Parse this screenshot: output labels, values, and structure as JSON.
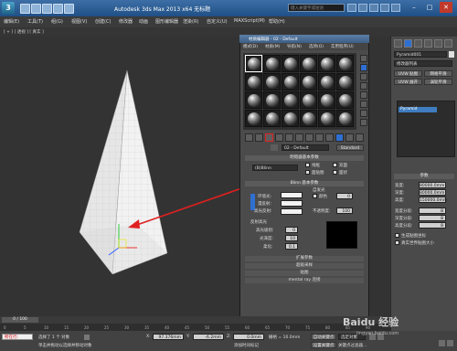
{
  "window": {
    "title": "Autodesk 3ds Max  2013 x64    无标题",
    "search_placeholder": "键入关键字或短语",
    "controls": [
      "–",
      "□",
      "✕"
    ]
  },
  "menubar": {
    "items": [
      "编辑(E)",
      "工具(T)",
      "组(G)",
      "视图(V)",
      "创建(C)",
      "修改器",
      "动画",
      "图形编辑器",
      "渲染(R)",
      "自定义(U)",
      "MAXScript(M)",
      "帮助(H)"
    ]
  },
  "viewport": {
    "label": "[ + ] [ 透视 ] [ 真实 ]"
  },
  "material_editor": {
    "title": "材质编辑器 - 02 - Default",
    "menu": [
      "模式(D)",
      "材质(M)",
      "导航(N)",
      "选项(O)",
      "实用程序(U)"
    ],
    "material_name": "02 - Default",
    "material_type": "Standard",
    "shader_rollout": "明暗器基本参数",
    "shader_type": "(B)Blinn",
    "shader_options": [
      "线框",
      "双面",
      "面贴图",
      "面状"
    ],
    "blinn_rollout": "Blinn 基本参数",
    "self_illum_label": "自发光",
    "color_label": "颜色",
    "color_value": "0",
    "ambient_label": "环境光:",
    "diffuse_label": "漫反射:",
    "specular_label": "高光反射:",
    "opacity_label": "不透明度:",
    "opacity_value": "100",
    "specular_highlights_label": "反射高光",
    "specular_level_label": "高光级别:",
    "specular_level_value": "0",
    "glossiness_label": "光泽度:",
    "glossiness_value": "10",
    "soften_label": "柔化:",
    "soften_value": "0.1",
    "closed_rollouts": [
      "扩展参数",
      "超级采样",
      "贴图",
      "mental ray 连接"
    ]
  },
  "command_panel": {
    "object_name": "Pyramid001",
    "modifier_list": "修改器列表",
    "buttons": [
      "UVW 贴图",
      "网格平滑",
      "UVW 展开",
      "涡轮平滑"
    ],
    "modifier_stack_item": "Pyramid",
    "params_header": "参数",
    "params": [
      {
        "label": "宽度:",
        "value": "80000.0mm"
      },
      {
        "label": "深度:",
        "value": "80000.0mm"
      },
      {
        "label": "高度:",
        "value": "150000.0mm"
      },
      {
        "label": "宽度分段:",
        "value": "8"
      },
      {
        "label": "深度分段:",
        "value": "8"
      },
      {
        "label": "高度分段:",
        "value": "8"
      }
    ],
    "checkboxes": [
      "生成贴图坐标",
      "真实世界贴图大小"
    ]
  },
  "timeline": {
    "slider_label": "0 / 100",
    "ticks": [
      "0",
      "5",
      "10",
      "15",
      "20",
      "25",
      "30",
      "35",
      "40",
      "45",
      "50",
      "55",
      "60",
      "65",
      "70",
      "75",
      "80",
      "85",
      "90"
    ]
  },
  "status": {
    "left_box": "所在行:",
    "selection": "选择了 1 个 对象",
    "prompt": "单击并拖动以选择并移动对象",
    "x_label": "X:",
    "x_value": "97.376mm",
    "y_label": "Y:",
    "y_value": "-6.2mm",
    "z_label": "Z:",
    "z_value": "0.0mm",
    "grid": "栅格 = 10.0mm",
    "autokey": "自动关键点",
    "setkey": "设置关键点",
    "selected": "选定对象",
    "add_time_tag": "添加时间标记",
    "key_filter": "关键点过滤器..."
  },
  "watermark": {
    "main": "Baidu 经验",
    "sub": "jingyan.baidu.com"
  },
  "colors": {
    "title_blue": "#2d5f96",
    "highlight_red": "#e02020",
    "selection_blue": "#3f7dc0"
  }
}
